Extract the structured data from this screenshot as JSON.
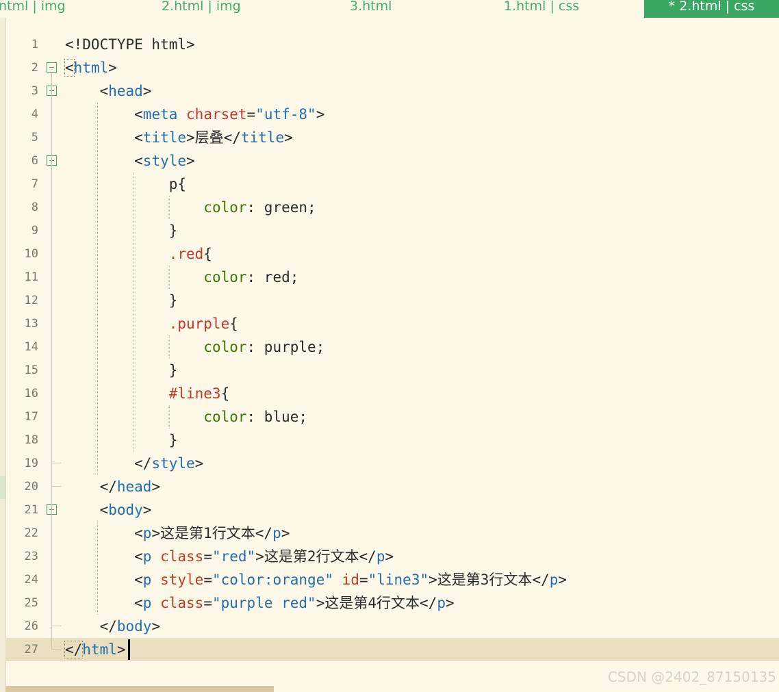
{
  "tabs": [
    {
      "label": "ntml | img",
      "active": false
    },
    {
      "label": "2.html | img",
      "active": false
    },
    {
      "label": "3.html",
      "active": false
    },
    {
      "label": "1.html | css",
      "active": false
    },
    {
      "label": "* 2.html | css",
      "active": true
    }
  ],
  "colors": {
    "tag": "#1f6fb0",
    "attribute": "#c0392b",
    "string": "#1f6fb0",
    "css_property": "#3c7a00",
    "text": "#2b2b2b",
    "active_tab": "#3aa762",
    "background": "#fdf8e7"
  },
  "editor": {
    "current_line": 27,
    "lines": [
      {
        "num": "1",
        "tokens": [
          [
            "punct",
            "<!DOCTYPE html>"
          ]
        ]
      },
      {
        "num": "2",
        "fold": "open",
        "tokens": [
          [
            "punct",
            "<"
          ],
          [
            "tag",
            "html"
          ],
          [
            "punct",
            ">"
          ]
        ]
      },
      {
        "num": "3",
        "fold": "open",
        "tokens": [
          [
            "punct",
            "    <"
          ],
          [
            "tag",
            "head"
          ],
          [
            "punct",
            ">"
          ]
        ]
      },
      {
        "num": "4",
        "tokens": [
          [
            "punct",
            "        <"
          ],
          [
            "tag",
            "meta"
          ],
          [
            "punct",
            " "
          ],
          [
            "attr",
            "charset"
          ],
          [
            "punct",
            "="
          ],
          [
            "str",
            "\"utf-8\""
          ],
          [
            "punct",
            ">"
          ]
        ]
      },
      {
        "num": "5",
        "tokens": [
          [
            "punct",
            "        <"
          ],
          [
            "tag",
            "title"
          ],
          [
            "punct",
            ">"
          ],
          [
            "text",
            "层叠"
          ],
          [
            "punct",
            "</"
          ],
          [
            "tag",
            "title"
          ],
          [
            "punct",
            ">"
          ]
        ]
      },
      {
        "num": "6",
        "fold": "open",
        "tokens": [
          [
            "punct",
            "        <"
          ],
          [
            "tag",
            "style"
          ],
          [
            "punct",
            ">"
          ]
        ]
      },
      {
        "num": "7",
        "tokens": [
          [
            "sel",
            "            p{"
          ]
        ]
      },
      {
        "num": "8",
        "tokens": [
          [
            "punct",
            "                "
          ],
          [
            "prop",
            "color"
          ],
          [
            "punct",
            ": green;"
          ]
        ]
      },
      {
        "num": "9",
        "tokens": [
          [
            "punct",
            "            }"
          ]
        ]
      },
      {
        "num": "10",
        "tokens": [
          [
            "punct",
            "            "
          ],
          [
            "cls",
            ".red"
          ],
          [
            "punct",
            "{"
          ]
        ]
      },
      {
        "num": "11",
        "tokens": [
          [
            "punct",
            "                "
          ],
          [
            "prop",
            "color"
          ],
          [
            "punct",
            ": red;"
          ]
        ]
      },
      {
        "num": "12",
        "tokens": [
          [
            "punct",
            "            }"
          ]
        ]
      },
      {
        "num": "13",
        "tokens": [
          [
            "punct",
            "            "
          ],
          [
            "cls",
            ".purple"
          ],
          [
            "punct",
            "{"
          ]
        ]
      },
      {
        "num": "14",
        "tokens": [
          [
            "punct",
            "                "
          ],
          [
            "prop",
            "color"
          ],
          [
            "punct",
            ": purple;"
          ]
        ]
      },
      {
        "num": "15",
        "tokens": [
          [
            "punct",
            "            }"
          ]
        ]
      },
      {
        "num": "16",
        "tokens": [
          [
            "punct",
            "            "
          ],
          [
            "cls",
            "#line3"
          ],
          [
            "punct",
            "{"
          ]
        ]
      },
      {
        "num": "17",
        "tokens": [
          [
            "punct",
            "                "
          ],
          [
            "prop",
            "color"
          ],
          [
            "punct",
            ": blue;"
          ]
        ]
      },
      {
        "num": "18",
        "tokens": [
          [
            "punct",
            "            }"
          ]
        ]
      },
      {
        "num": "19",
        "fold": "end",
        "tokens": [
          [
            "punct",
            "        </"
          ],
          [
            "tag",
            "style"
          ],
          [
            "punct",
            ">"
          ]
        ]
      },
      {
        "num": "20",
        "fold": "end",
        "tokens": [
          [
            "punct",
            "    </"
          ],
          [
            "tag",
            "head"
          ],
          [
            "punct",
            ">"
          ]
        ]
      },
      {
        "num": "21",
        "fold": "open",
        "tokens": [
          [
            "punct",
            "    <"
          ],
          [
            "tag",
            "body"
          ],
          [
            "punct",
            ">"
          ]
        ]
      },
      {
        "num": "22",
        "tokens": [
          [
            "punct",
            "        <"
          ],
          [
            "tag",
            "p"
          ],
          [
            "punct",
            ">"
          ],
          [
            "text",
            "这是第1行文本"
          ],
          [
            "punct",
            "</"
          ],
          [
            "tag",
            "p"
          ],
          [
            "punct",
            ">"
          ]
        ]
      },
      {
        "num": "23",
        "tokens": [
          [
            "punct",
            "        <"
          ],
          [
            "tag",
            "p"
          ],
          [
            "punct",
            " "
          ],
          [
            "attr",
            "class"
          ],
          [
            "punct",
            "="
          ],
          [
            "str",
            "\"red\""
          ],
          [
            "punct",
            ">"
          ],
          [
            "text",
            "这是第2行文本"
          ],
          [
            "punct",
            "</"
          ],
          [
            "tag",
            "p"
          ],
          [
            "punct",
            ">"
          ]
        ]
      },
      {
        "num": "24",
        "tokens": [
          [
            "punct",
            "        <"
          ],
          [
            "tag",
            "p"
          ],
          [
            "punct",
            " "
          ],
          [
            "attr",
            "style"
          ],
          [
            "punct",
            "="
          ],
          [
            "str",
            "\"color:orange\""
          ],
          [
            "punct",
            " "
          ],
          [
            "attr",
            "id"
          ],
          [
            "punct",
            "="
          ],
          [
            "str",
            "\"line3\""
          ],
          [
            "punct",
            ">"
          ],
          [
            "text",
            "这是第3行文本"
          ],
          [
            "punct",
            "</"
          ],
          [
            "tag",
            "p"
          ],
          [
            "punct",
            ">"
          ]
        ]
      },
      {
        "num": "25",
        "tokens": [
          [
            "punct",
            "        <"
          ],
          [
            "tag",
            "p"
          ],
          [
            "punct",
            " "
          ],
          [
            "attr",
            "class"
          ],
          [
            "punct",
            "="
          ],
          [
            "str",
            "\"purple red\""
          ],
          [
            "punct",
            ">"
          ],
          [
            "text",
            "这是第4行文本"
          ],
          [
            "punct",
            "</"
          ],
          [
            "tag",
            "p"
          ],
          [
            "punct",
            ">"
          ]
        ]
      },
      {
        "num": "26",
        "fold": "end",
        "tokens": [
          [
            "punct",
            "    </"
          ],
          [
            "tag",
            "body"
          ],
          [
            "punct",
            ">"
          ]
        ]
      },
      {
        "num": "27",
        "fold": "end",
        "tokens": [
          [
            "punct",
            "</"
          ],
          [
            "tag",
            "html"
          ],
          [
            "punct",
            ">"
          ]
        ]
      }
    ]
  },
  "watermark": "CSDN @2402_87150135"
}
